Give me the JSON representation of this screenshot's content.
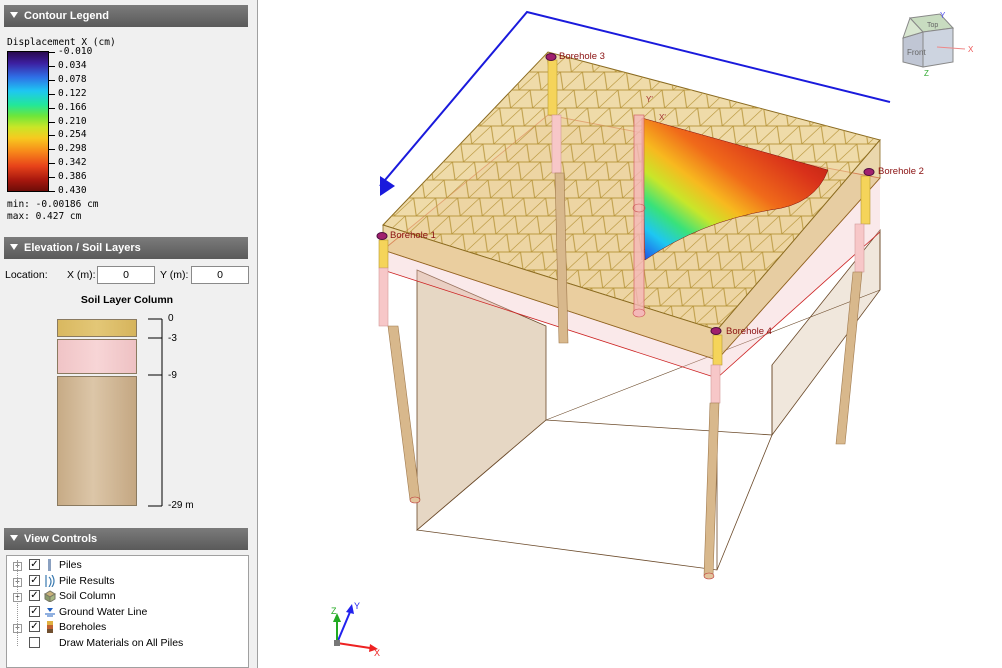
{
  "contour_legend": {
    "header": "Contour Legend",
    "title": "Displacement X (cm)",
    "ticks": [
      "-0.010",
      "0.034",
      "0.078",
      "0.122",
      "0.166",
      "0.210",
      "0.254",
      "0.298",
      "0.342",
      "0.386",
      "0.430"
    ],
    "min_text": "min: -0.00186 cm",
    "max_text": "max: 0.427 cm"
  },
  "elevation": {
    "header": "Elevation / Soil Layers",
    "location_label": "Location:",
    "x_label": "X (m):",
    "x_value": "0",
    "y_label": "Y (m):",
    "y_value": "0",
    "column_title": "Soil Layer Column",
    "scale_labels": [
      "0",
      "-3",
      "-9",
      "-29 m"
    ],
    "layer_colors": [
      "#e3c777",
      "#f7d5d6",
      "#d2b999"
    ]
  },
  "view_controls": {
    "header": "View Controls",
    "items": [
      {
        "label": "Piles",
        "checked": "✓"
      },
      {
        "label": "Pile Results",
        "checked": "✓"
      },
      {
        "label": "Soil Column",
        "checked": "✓"
      },
      {
        "label": "Ground Water Line",
        "checked": "✓"
      },
      {
        "label": "Boreholes",
        "checked": "✓"
      },
      {
        "label": "Draw Materials on All Piles",
        "checked": ""
      }
    ]
  },
  "viewport": {
    "boreholes": [
      "Borehole 1",
      "Borehole 2",
      "Borehole 3",
      "Borehole 4"
    ],
    "section_labels": [
      "Y'",
      "X'"
    ],
    "nav_cube": {
      "top": "Top",
      "front": "Front",
      "x": "X",
      "y": "Y",
      "z": "Z"
    },
    "triad": {
      "x": "X",
      "y": "Y",
      "z": "Z"
    }
  }
}
